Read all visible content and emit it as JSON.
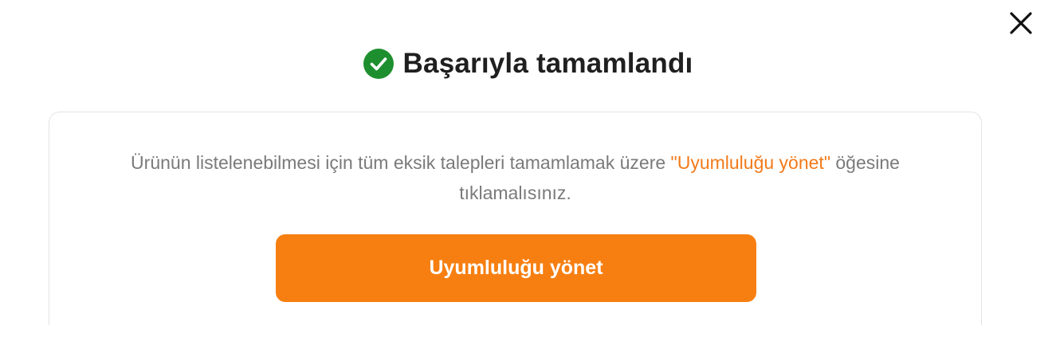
{
  "dialog": {
    "title": "Başarıyla tamamlandı",
    "message_before": "Ürünün listelenebilmesi için tüm eksik talepleri tamamlamak üzere ",
    "message_highlight": "\"Uyumluluğu yönet\"",
    "message_after": " öğesine tıklamalısınız.",
    "action_button_label": "Uyumluluğu yönet"
  },
  "icons": {
    "close": "close-icon",
    "success": "check-circle-icon"
  },
  "colors": {
    "accent": "#f77f11",
    "highlight_text": "#f27a1a",
    "success": "#1e8f2f",
    "body_text": "#7a7a7a",
    "title_text": "#1f1f1f"
  }
}
